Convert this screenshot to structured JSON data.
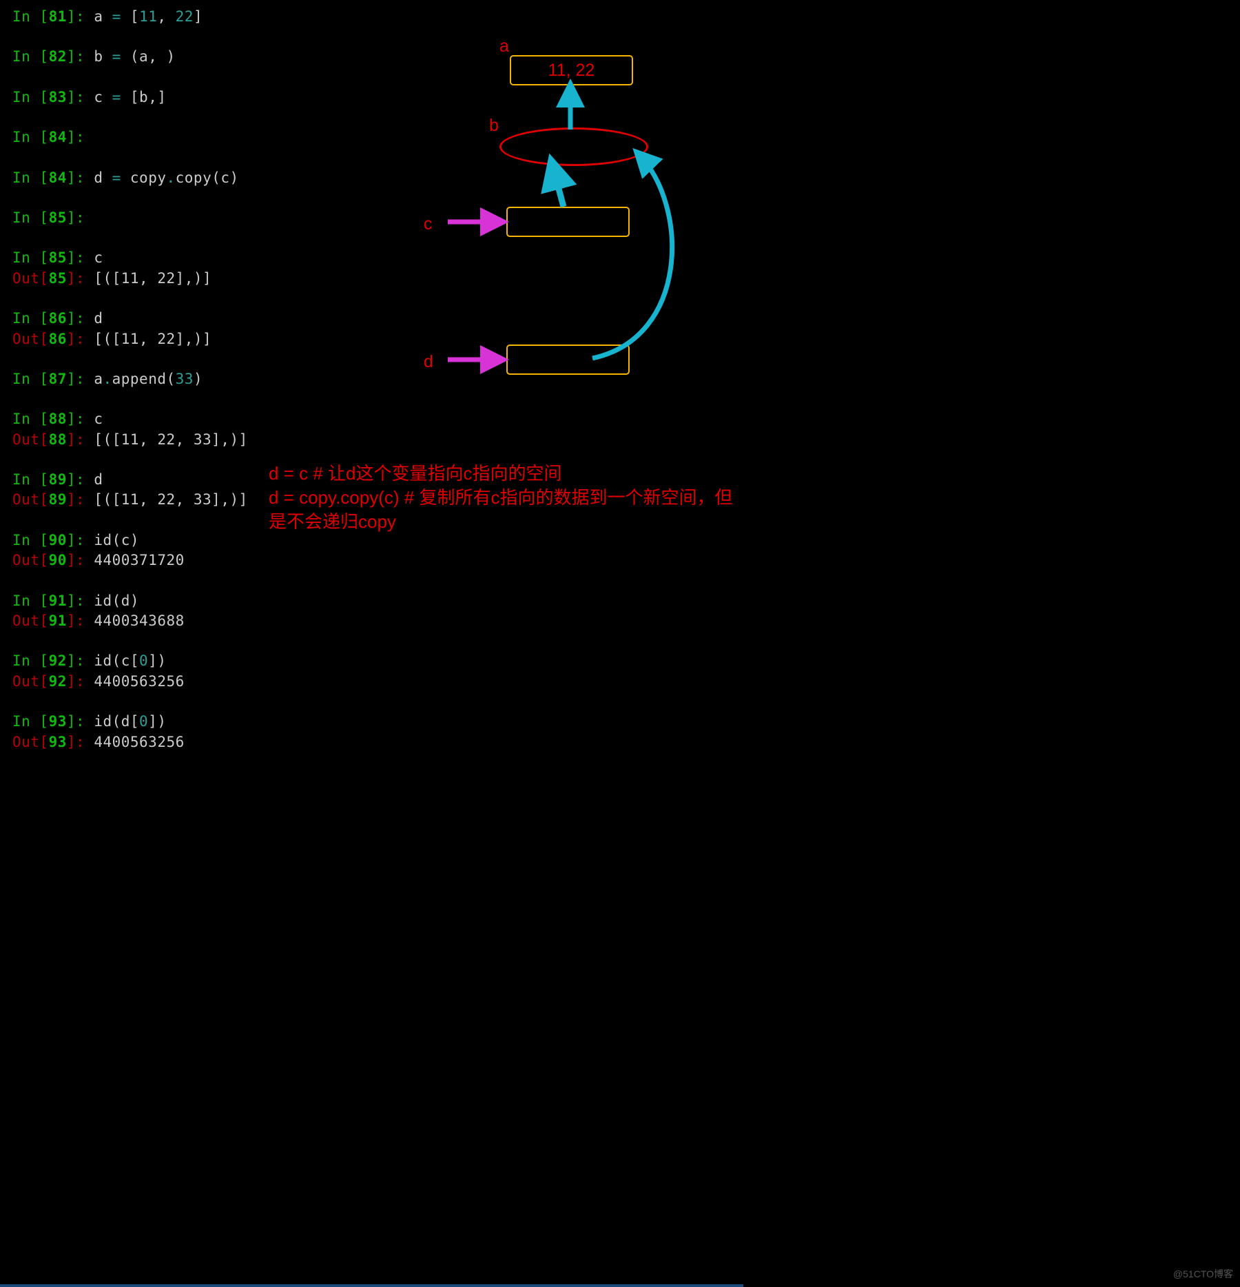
{
  "cells": [
    {
      "kind": "in",
      "n": "81",
      "code_parts": [
        [
          "code",
          "a "
        ],
        [
          "op",
          "="
        ],
        [
          "code",
          " ["
        ],
        [
          "lit",
          "11"
        ],
        [
          "code",
          ", "
        ],
        [
          "lit",
          "22"
        ],
        [
          "code",
          "]"
        ]
      ]
    },
    {
      "kind": "blank"
    },
    {
      "kind": "in",
      "n": "82",
      "code_parts": [
        [
          "code",
          "b "
        ],
        [
          "op",
          "="
        ],
        [
          "code",
          " (a, )"
        ]
      ]
    },
    {
      "kind": "blank"
    },
    {
      "kind": "in",
      "n": "83",
      "code_parts": [
        [
          "code",
          "c "
        ],
        [
          "op",
          "="
        ],
        [
          "code",
          " [b,]"
        ]
      ]
    },
    {
      "kind": "blank"
    },
    {
      "kind": "in",
      "n": "84",
      "code_parts": []
    },
    {
      "kind": "blank"
    },
    {
      "kind": "in",
      "n": "84",
      "code_parts": [
        [
          "code",
          "d "
        ],
        [
          "op",
          "="
        ],
        [
          "code",
          " copy"
        ],
        [
          "op",
          "."
        ],
        [
          "code",
          "copy(c)"
        ]
      ]
    },
    {
      "kind": "blank"
    },
    {
      "kind": "in",
      "n": "85",
      "code_parts": []
    },
    {
      "kind": "blank"
    },
    {
      "kind": "in",
      "n": "85",
      "code_parts": [
        [
          "code",
          "c"
        ]
      ]
    },
    {
      "kind": "out",
      "n": "85",
      "text": "[([11, 22],)]"
    },
    {
      "kind": "blank"
    },
    {
      "kind": "in",
      "n": "86",
      "code_parts": [
        [
          "code",
          "d"
        ]
      ]
    },
    {
      "kind": "out",
      "n": "86",
      "text": "[([11, 22],)]"
    },
    {
      "kind": "blank"
    },
    {
      "kind": "in",
      "n": "87",
      "code_parts": [
        [
          "code",
          "a"
        ],
        [
          "op",
          "."
        ],
        [
          "code",
          "append("
        ],
        [
          "lit",
          "33"
        ],
        [
          "code",
          ")"
        ]
      ]
    },
    {
      "kind": "blank"
    },
    {
      "kind": "in",
      "n": "88",
      "code_parts": [
        [
          "code",
          "c"
        ]
      ]
    },
    {
      "kind": "out",
      "n": "88",
      "text": "[([11, 22, 33],)]"
    },
    {
      "kind": "blank"
    },
    {
      "kind": "in",
      "n": "89",
      "code_parts": [
        [
          "code",
          "d"
        ]
      ]
    },
    {
      "kind": "out",
      "n": "89",
      "text": "[([11, 22, 33],)]"
    },
    {
      "kind": "blank"
    },
    {
      "kind": "in",
      "n": "90",
      "code_parts": [
        [
          "code",
          "id(c)"
        ]
      ]
    },
    {
      "kind": "out",
      "n": "90",
      "text": "4400371720"
    },
    {
      "kind": "blank"
    },
    {
      "kind": "in",
      "n": "91",
      "code_parts": [
        [
          "code",
          "id(d)"
        ]
      ]
    },
    {
      "kind": "out",
      "n": "91",
      "text": "4400343688"
    },
    {
      "kind": "blank"
    },
    {
      "kind": "in",
      "n": "92",
      "code_parts": [
        [
          "code",
          "id(c["
        ],
        [
          "lit",
          "0"
        ],
        [
          "code",
          "])"
        ]
      ]
    },
    {
      "kind": "out",
      "n": "92",
      "text": "4400563256"
    },
    {
      "kind": "blank"
    },
    {
      "kind": "in",
      "n": "93",
      "code_parts": [
        [
          "code",
          "id(d["
        ],
        [
          "lit",
          "0"
        ],
        [
          "code",
          "])"
        ]
      ]
    },
    {
      "kind": "out",
      "n": "93",
      "text": "4400563256"
    }
  ],
  "diagram": {
    "labels": {
      "a": "a",
      "b": "b",
      "c": "c",
      "d": "d"
    },
    "box_a_text": "11, 22"
  },
  "note": {
    "line1": "d = c  # 让d这个变量指向c指向的空间",
    "line2": "d = copy.copy(c) # 复制所有c指向的数据到一个新空间，但是不会递归copy"
  },
  "watermark": "@51CTO博客"
}
